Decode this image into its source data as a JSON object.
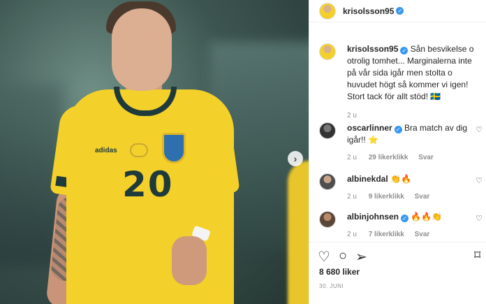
{
  "post": {
    "username": "krisolsson95",
    "verified_mark": "✓",
    "caption": "Sån besvikelse o otrolig tomhet... Marginalerna inte på vår sida igår men stolta o huvudet högt så kommer vi igen! Stort tack för allt stöd! 🇸🇪",
    "caption_age": "2 u",
    "likes": "8 680 liker",
    "date": "30. JUNI",
    "photo": {
      "jersey_number": "20",
      "sponsor": "adidas"
    }
  },
  "comments": [
    {
      "user": "oscarlinner",
      "verified": true,
      "text": "Bra match av dig igår!! ⭐",
      "age": "2 u",
      "likes": "29 likerklikk",
      "reply": "Svar"
    },
    {
      "user": "albinekdal",
      "verified": false,
      "text": "👏🔥",
      "age": "2 u",
      "likes": "9 likerklikk",
      "reply": "Svar"
    },
    {
      "user": "albinjohnsen",
      "verified": true,
      "text": "🔥🔥👏",
      "age": "2 u",
      "likes": "7 likerklikk",
      "reply": "Svar"
    }
  ],
  "icons": {
    "like": "heart-icon",
    "comment": "comment-icon",
    "share": "share-icon",
    "save": "bookmark-icon",
    "next": "chevron-right-icon"
  },
  "colors": {
    "verified": "#3897f0",
    "jersey": "#f3d02a",
    "trim": "#1f3a3a"
  }
}
